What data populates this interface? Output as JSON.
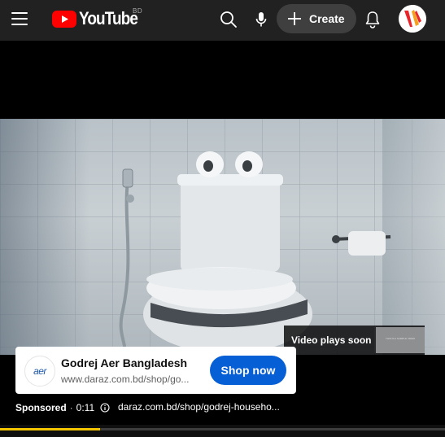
{
  "header": {
    "logo_text": "YouTube",
    "country_code": "BD",
    "create_label": "Create"
  },
  "player": {
    "overlay_label": "Video plays soon",
    "thumb_caption": "THIS IS A SAMPLE VIDEO",
    "progress_fraction": 0.225,
    "progress_color": "#f2c500"
  },
  "ad": {
    "advertiser": "Godrej Aer Bangladesh",
    "logo_text": "aer",
    "display_url": "www.daraz.com.bd/shop/go...",
    "cta_label": "Shop now",
    "cta_color": "#065fd4",
    "sponsored_label": "Sponsored",
    "separator": "·",
    "time": "0:11",
    "link_text": "daraz.com.bd/shop/godrej-househo..."
  },
  "icons": [
    "menu-icon",
    "youtube-logo-icon",
    "search-icon",
    "microphone-icon",
    "plus-icon",
    "bell-icon",
    "info-icon"
  ]
}
